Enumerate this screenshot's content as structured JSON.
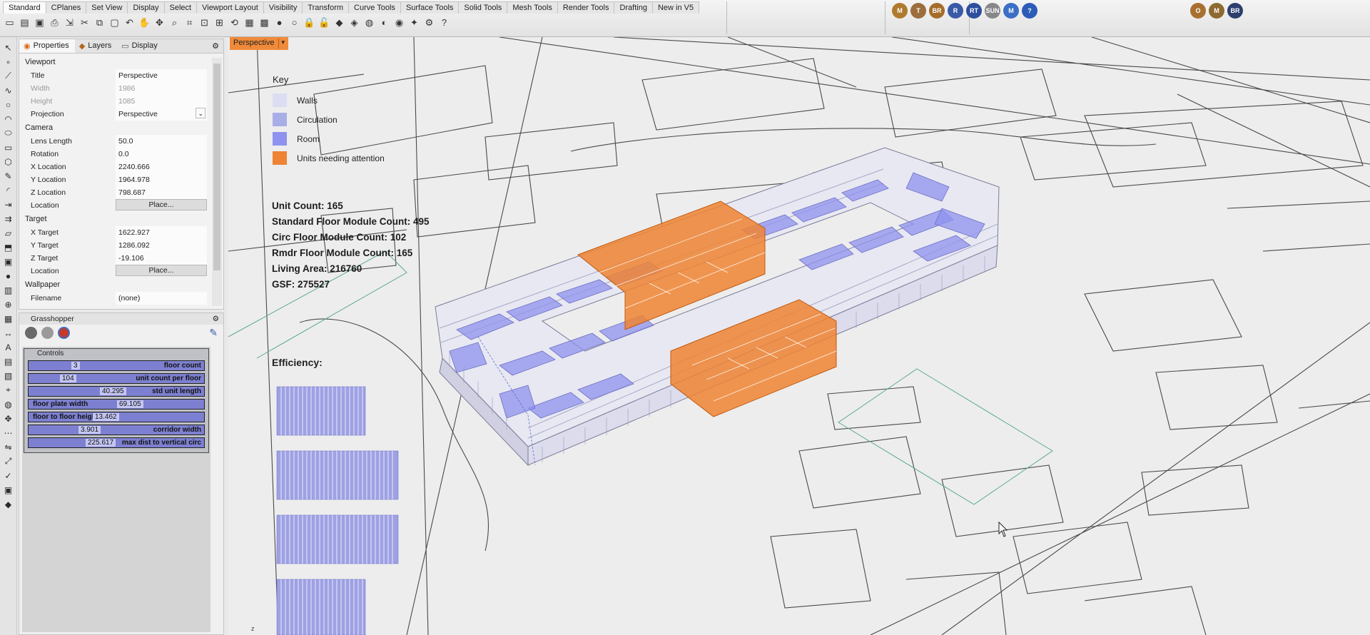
{
  "toolbar": {
    "tabs": [
      "Standard",
      "CPlanes",
      "Set View",
      "Display",
      "Select",
      "Viewport Layout",
      "Visibility",
      "Transform",
      "Curve Tools",
      "Surface Tools",
      "Solid Tools",
      "Mesh Tools",
      "Render Tools",
      "Drafting",
      "New in V5"
    ],
    "active_tab": "Standard",
    "icons": [
      "new-file-icon",
      "open-icon",
      "save-icon",
      "print-icon",
      "import-icon",
      "cut-icon",
      "copy-icon",
      "paste-icon",
      "undo-icon",
      "pan-icon",
      "move-icon",
      "zoom-icon",
      "zoom-window-icon",
      "zoom-extents-icon",
      "zoom-selected-icon",
      "rotate-view-icon",
      "viewport-layout-icon",
      "grid-icon",
      "hide-icon",
      "show-icon",
      "lock-icon",
      "unlock-icon",
      "layer-icon",
      "properties-icon",
      "render-icon",
      "material-icon",
      "sphere-icon",
      "light-icon",
      "options-icon",
      "help-icon"
    ],
    "render_tools": [
      "M",
      "T",
      "BR",
      "R",
      "RT",
      "SUN",
      "M",
      "?"
    ],
    "render_tools_2": [
      "O",
      "M",
      "BR"
    ]
  },
  "left_tools": [
    "select-icon",
    "point-icon",
    "polyline-icon",
    "curve-icon",
    "circle-icon",
    "arc-icon",
    "ellipse-icon",
    "rectangle-icon",
    "polygon-icon",
    "freeform-icon",
    "fillet-icon",
    "extend-icon",
    "offset-icon",
    "surface-icon",
    "extrude-icon",
    "box-icon",
    "sphere-icon",
    "cylinder-icon",
    "boolean-icon",
    "mesh-icon",
    "dimension-icon",
    "text-icon",
    "hatch-icon",
    "block-icon",
    "analyze-icon",
    "render-icon",
    "transform-icon",
    "array-icon",
    "mirror-icon",
    "scale-icon",
    "check-icon",
    "group-icon",
    "layer-icon"
  ],
  "properties": {
    "tabs": [
      {
        "label": "Properties",
        "icon": "properties-icon"
      },
      {
        "label": "Layers",
        "icon": "layers-icon"
      },
      {
        "label": "Display",
        "icon": "display-icon"
      }
    ],
    "sections": {
      "viewport": "Viewport",
      "camera": "Camera",
      "target": "Target",
      "wallpaper": "Wallpaper"
    },
    "rows": {
      "title": {
        "label": "Title",
        "value": "Perspective"
      },
      "width": {
        "label": "Width",
        "value": "1986"
      },
      "height": {
        "label": "Height",
        "value": "1085"
      },
      "projection": {
        "label": "Projection",
        "value": "Perspective"
      },
      "lens_length": {
        "label": "Lens Length",
        "value": "50.0"
      },
      "rotation": {
        "label": "Rotation",
        "value": "0.0"
      },
      "x_location": {
        "label": "X Location",
        "value": "2240.666"
      },
      "y_location": {
        "label": "Y Location",
        "value": "1964.978"
      },
      "z_location": {
        "label": "Z Location",
        "value": "798.687"
      },
      "location": {
        "label": "Location",
        "button": "Place..."
      },
      "x_target": {
        "label": "X Target",
        "value": "1622.927"
      },
      "y_target": {
        "label": "Y Target",
        "value": "1286.092"
      },
      "z_target": {
        "label": "Z Target",
        "value": "-19.106"
      },
      "target_location": {
        "label": "Location",
        "button": "Place..."
      },
      "filename": {
        "label": "Filename",
        "value": "(none)"
      }
    }
  },
  "grasshopper": {
    "title": "Grasshopper",
    "group_title": "Controls",
    "sliders": [
      {
        "name": "floor count",
        "value": "3",
        "fill": 0.3
      },
      {
        "name": "unit count per floor",
        "value": "104",
        "fill": 0.22
      },
      {
        "name": "std unit length",
        "value": "40.295",
        "fill": 0.5
      },
      {
        "name": "floor plate width",
        "value": "69.105",
        "fill": 0.62
      },
      {
        "name": "floor to floor height",
        "value": "13.462",
        "fill": 0.45
      },
      {
        "name": "corridor width",
        "value": "3.901",
        "fill": 0.35
      },
      {
        "name": "max dist to vertical circ",
        "value": "225.617",
        "fill": 0.4
      }
    ]
  },
  "viewport": {
    "label": "Perspective",
    "key": {
      "title": "Key",
      "items": [
        {
          "label": "Walls",
          "color": "#dcdcf2"
        },
        {
          "label": "Circulation",
          "color": "#aaaee8"
        },
        {
          "label": "Room",
          "color": "#8f92ee"
        },
        {
          "label": "Units needing attention",
          "color": "#ee8433"
        }
      ]
    },
    "stats": {
      "unit_count": "Unit Count: 165",
      "standard_floor": "Standard Floor Module Count: 495",
      "circ_floor": "Circ Floor Module Count: 102",
      "rmdr_floor": "Rmdr Floor Module Count: 165",
      "living_area": "Living Area: 216760",
      "gsf": "GSF: 275527"
    },
    "efficiency_title": "Efficiency:",
    "axis_label": "z"
  }
}
